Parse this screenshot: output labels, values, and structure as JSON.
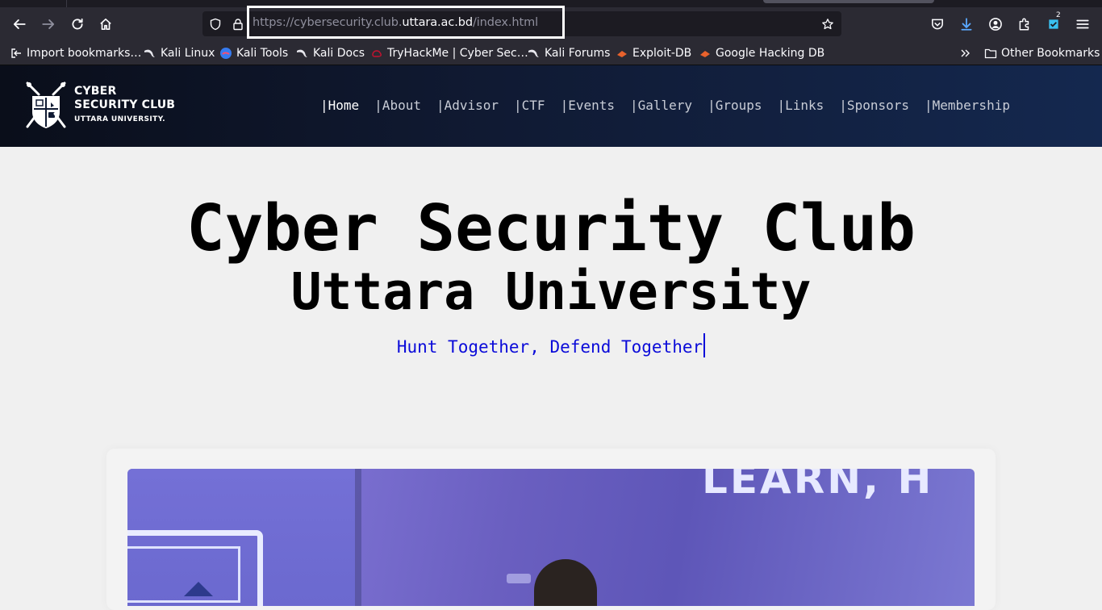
{
  "browser": {
    "url_prefix": "https://cybersecurity.club.",
    "url_host": "uttara.ac.bd",
    "url_suffix": "/index.html",
    "extension_badge": "2",
    "bookmarks": [
      {
        "label": "Import bookmarks…",
        "icon": "import-icon"
      },
      {
        "label": "Kali Linux",
        "icon": "kali-dragon-icon"
      },
      {
        "label": "Kali Tools",
        "icon": "kali-tools-icon"
      },
      {
        "label": "Kali Docs",
        "icon": "kali-dragon-icon"
      },
      {
        "label": "TryHackMe | Cyber Sec…",
        "icon": "tryhackme-icon"
      },
      {
        "label": "Kali Forums",
        "icon": "kali-dragon-icon"
      },
      {
        "label": "Exploit-DB",
        "icon": "exploit-db-icon"
      },
      {
        "label": "Google Hacking DB",
        "icon": "exploit-db-icon"
      }
    ],
    "other_bookmarks": "Other Bookmarks"
  },
  "site": {
    "logo": {
      "line1": "CYBER",
      "line2": "SECURITY CLUB",
      "line3": "UTTARA UNIVERSITY."
    },
    "nav": [
      "|Home",
      "|About",
      "|Advisor",
      "|CTF",
      "|Events",
      "|Gallery",
      "|Groups",
      "|Links",
      "|Sponsors",
      "|Membership"
    ],
    "hero_title": "Cyber Security Club",
    "hero_subtitle": "Uttara University",
    "tagline": "Hunt Together, Defend Together",
    "photo_banner_text": "LEARN, H"
  },
  "colors": {
    "accent": "#0b0bd9",
    "header_bg": "#101a33",
    "page_bg": "#f0f0f0"
  }
}
